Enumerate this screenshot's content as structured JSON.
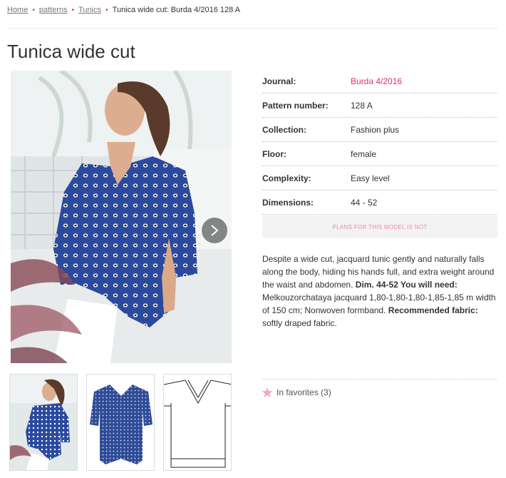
{
  "breadcrumb": {
    "items": [
      "Home",
      "patterns",
      "Tunics"
    ],
    "current": "Tunica wide cut: Burda 4/2016 128 A"
  },
  "page_title": "Tunica wide cut",
  "info": {
    "journal": {
      "label": "Journal:",
      "value": "Burda 4/2016"
    },
    "pattern_number": {
      "label": "Pattern number:",
      "value": "128 A"
    },
    "collection": {
      "label": "Collection:",
      "value": "Fashion plus"
    },
    "floor": {
      "label": "Floor:",
      "value": "female"
    },
    "complexity": {
      "label": "Complexity:",
      "value": "Easy level"
    },
    "dimensions": {
      "label": "Dimensions:",
      "value": "44 - 52"
    }
  },
  "plans_notice": "PLANS FOR THIS MODEL IS NOT",
  "description": {
    "intro": "Despite a wide cut, jacquard tunic gently and naturally falls along the body, hiding his hands full, and extra weight around the waist and abdomen.",
    "need_label": "Dim. 44-52 You will need:",
    "materials": "Melkouzorchataya jacquard 1,80-1,80-1,80-1,85-1,85 m width of 150 cm; Nonwoven formband.",
    "fabric_label": "Recommended fabric:",
    "fabric": "softly draped fabric."
  },
  "favorites": {
    "label": "In favorites (3)"
  },
  "colors": {
    "accent": "#e0325f",
    "tunic_blue": "#2b4a9e",
    "star": "#f2a9bc"
  }
}
